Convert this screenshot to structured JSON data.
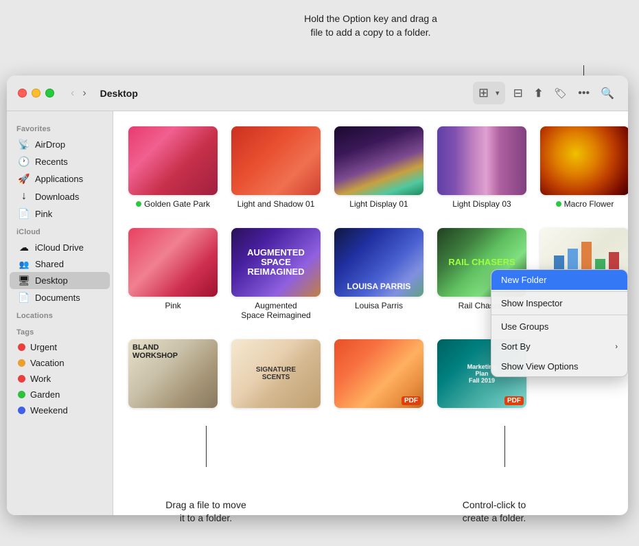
{
  "annotations": {
    "top": "Hold the Option key and drag a\nfile to add a copy to a folder.",
    "bottom_left": "Drag a file to move\nit to a folder.",
    "bottom_right": "Control-click to\ncreate a folder."
  },
  "window": {
    "title": "Desktop",
    "back_button": "‹",
    "forward_button": "›"
  },
  "toolbar": {
    "view_grid_icon": "⊞",
    "view_list_icon": "≡",
    "share_icon": "↑",
    "tag_icon": "🏷",
    "more_icon": "•••",
    "search_icon": "🔍"
  },
  "sidebar": {
    "sections": [
      {
        "label": "Favorites",
        "items": [
          {
            "id": "airdrop",
            "label": "AirDrop",
            "icon": "📡"
          },
          {
            "id": "recents",
            "label": "Recents",
            "icon": "🕐"
          },
          {
            "id": "applications",
            "label": "Applications",
            "icon": "🚀"
          },
          {
            "id": "downloads",
            "label": "Downloads",
            "icon": "↓"
          },
          {
            "id": "pink",
            "label": "Pink",
            "icon": "📄"
          }
        ]
      },
      {
        "label": "iCloud",
        "items": [
          {
            "id": "icloud-drive",
            "label": "iCloud Drive",
            "icon": "☁"
          },
          {
            "id": "shared",
            "label": "Shared",
            "icon": "👥"
          },
          {
            "id": "desktop",
            "label": "Desktop",
            "icon": "🖥",
            "active": true
          },
          {
            "id": "documents",
            "label": "Documents",
            "icon": "📄"
          }
        ]
      },
      {
        "label": "Locations",
        "items": []
      },
      {
        "label": "Tags",
        "items": [
          {
            "id": "urgent",
            "label": "Urgent",
            "color": "#e84040"
          },
          {
            "id": "vacation",
            "label": "Vacation",
            "color": "#e8a030"
          },
          {
            "id": "work",
            "label": "Work",
            "color": "#e84040"
          },
          {
            "id": "garden",
            "label": "Garden",
            "color": "#30c040"
          },
          {
            "id": "weekend",
            "label": "Weekend",
            "color": "#4060e8"
          }
        ]
      }
    ]
  },
  "files": {
    "row1": [
      {
        "id": "golden-gate",
        "label": "Golden Gate Park",
        "status_color": "#28c840",
        "img_class": "img-golden-gate"
      },
      {
        "id": "light-shadow",
        "label": "Light and Shadow 01",
        "img_class": "img-light-shadow"
      },
      {
        "id": "light-display-01",
        "label": "Light Display 01",
        "img_class": "img-light-display-01"
      },
      {
        "id": "light-display-03",
        "label": "Light Display 03",
        "img_class": "img-light-display-03"
      },
      {
        "id": "macro-flower",
        "label": "Macro Flower",
        "status_color": "#28c840",
        "img_class": "img-macro-flower"
      }
    ],
    "row2": [
      {
        "id": "pink",
        "label": "Pink",
        "img_class": "img-pink"
      },
      {
        "id": "augmented",
        "label": "Augmented Space Reimagined",
        "img_class": "img-augmented",
        "has_text": true
      },
      {
        "id": "louisa",
        "label": "Louisa Parris",
        "img_class": "img-louisa"
      },
      {
        "id": "rail-chasers",
        "label": "Rail Chasers",
        "img_class": "img-rail-chasers"
      },
      {
        "id": "chart",
        "label": "",
        "img_class": "img-chart",
        "is_chart": true
      }
    ],
    "row3": [
      {
        "id": "bland-workshop",
        "label": "",
        "img_class": "img-bland-workshop"
      },
      {
        "id": "signature",
        "label": "",
        "img_class": "img-signature",
        "has_sig_text": true
      },
      {
        "id": "louisa-market",
        "label": "",
        "img_class": "img-louisa-market",
        "is_pdf": true
      },
      {
        "id": "marketing",
        "label": "",
        "img_class": "img-marketing",
        "is_marketing": true
      }
    ]
  },
  "context_menu": {
    "items": [
      {
        "id": "new-folder",
        "label": "New Folder",
        "highlighted": true
      },
      {
        "id": "show-inspector",
        "label": "Show Inspector",
        "highlighted": false
      },
      {
        "id": "use-groups",
        "label": "Use Groups",
        "highlighted": false
      },
      {
        "id": "sort-by",
        "label": "Sort By",
        "has_arrow": true,
        "highlighted": false
      },
      {
        "id": "show-view-options",
        "label": "Show View Options",
        "highlighted": false
      }
    ]
  }
}
